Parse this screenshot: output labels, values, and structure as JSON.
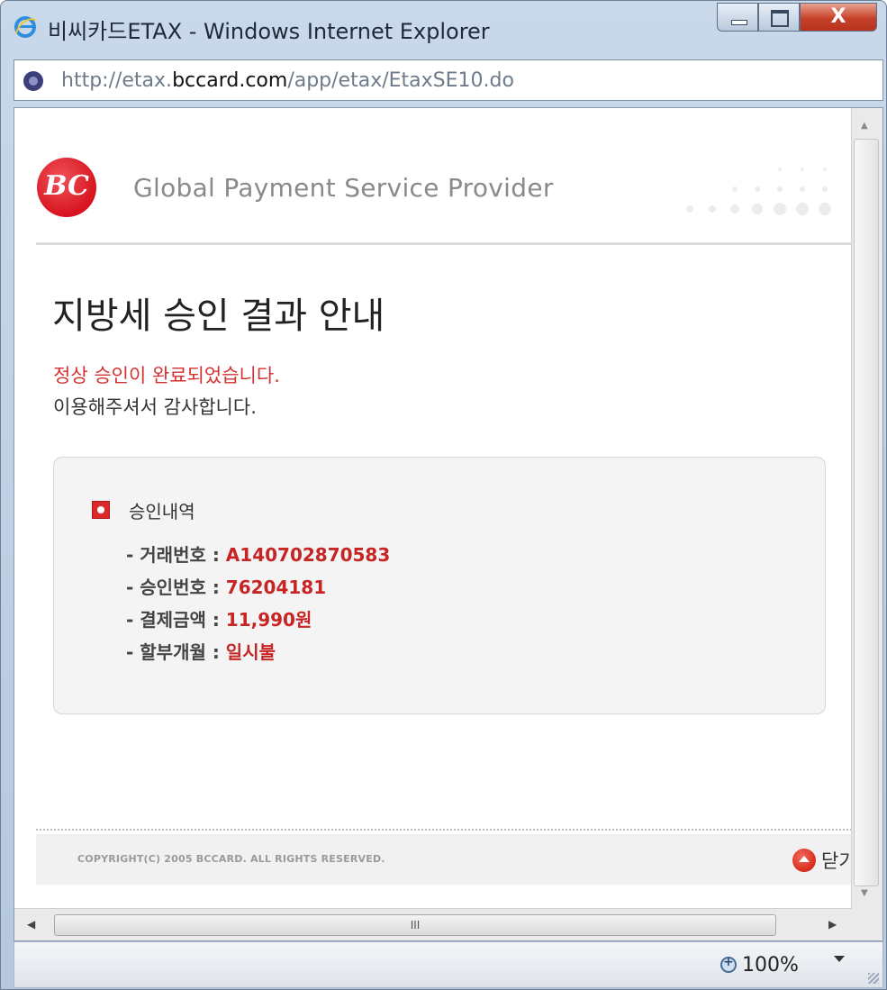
{
  "window": {
    "title": "비씨카드ETAX - Windows Internet Explorer",
    "controls": {
      "minimize": "",
      "maximize": "",
      "close": "X"
    }
  },
  "address": {
    "prefix": "http://etax.",
    "domain": "bccard.com",
    "path": "/app/etax/EtaxSE10.do"
  },
  "page": {
    "logo_text": "BC",
    "tagline": "Global Payment Service Provider",
    "title": "지방세 승인 결과 안내",
    "message_success": "정상 승인이 완료되었습니다.",
    "message_thanks": "이용해주셔서 감사합니다.",
    "details": {
      "heading": "승인내역",
      "rows": [
        {
          "label": "- 거래번호 : ",
          "value": "A140702870583"
        },
        {
          "label": "- 승인번호 : ",
          "value": "76204181"
        },
        {
          "label": "- 결제금액 : ",
          "value": "11,990원"
        },
        {
          "label": "- 할부개월 : ",
          "value": "일시불"
        }
      ]
    },
    "copyright": "COPYRIGHT(C) 2005 BCCARD. ALL RIGHTS RESERVED.",
    "close_label": "닫기"
  },
  "scrollbar": {
    "horizontal_thumb_grip": "III"
  },
  "status": {
    "zoom": "100%"
  },
  "colors": {
    "accent_red": "#c72424",
    "brand_red": "#d7141f"
  },
  "icons": [
    "ie-icon",
    "site-favicon-icon",
    "bc-logo",
    "bullet-icon",
    "close-up-icon",
    "zoom-icon",
    "dropdown-arrow-icon"
  ]
}
